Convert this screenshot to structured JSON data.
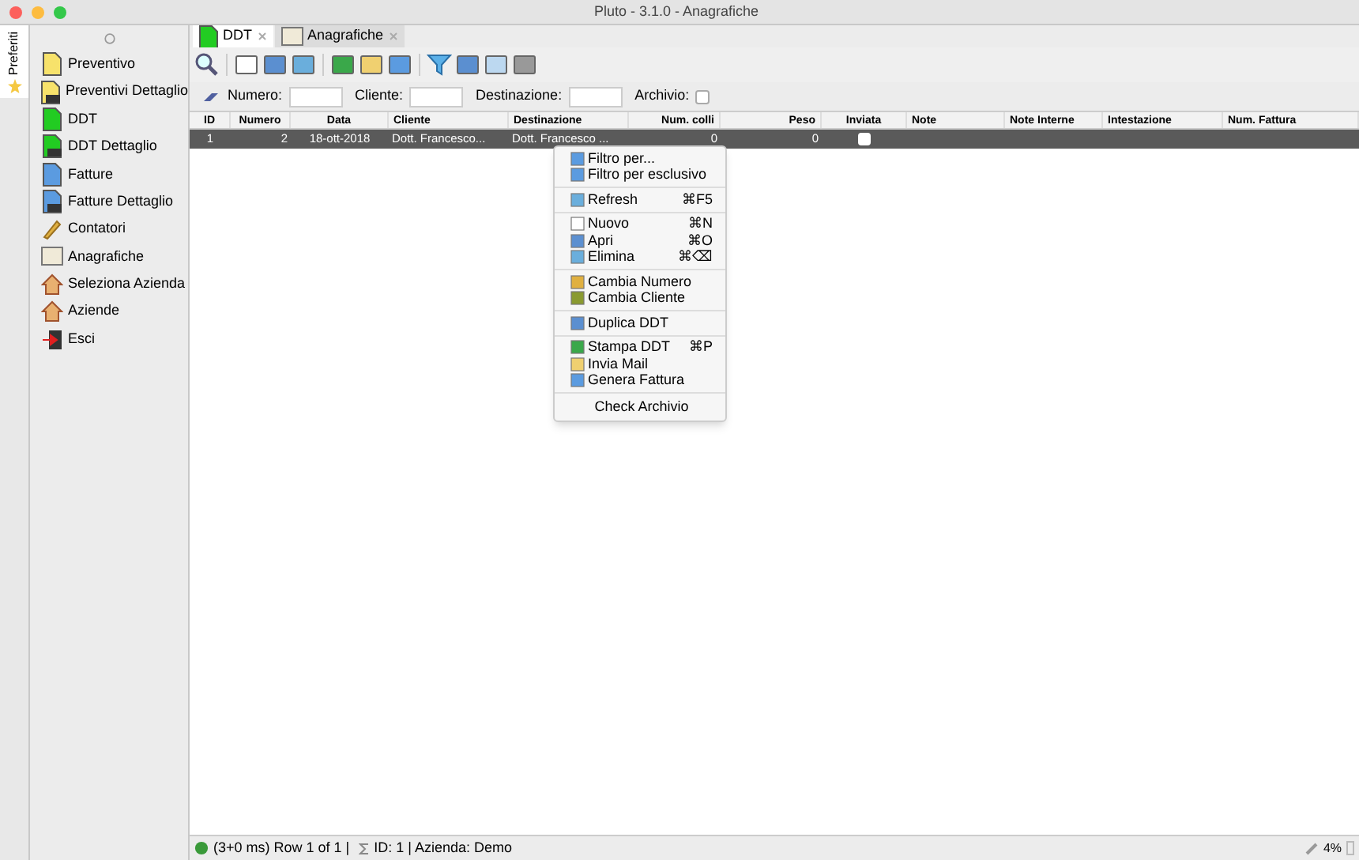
{
  "window": {
    "title": "Pluto - 3.1.0 - Anagrafiche"
  },
  "side_tab": {
    "label": "Preferiti"
  },
  "sidebar": {
    "items": [
      {
        "label": "Preventivo"
      },
      {
        "label": "Preventivi Dettaglio"
      },
      {
        "label": "DDT"
      },
      {
        "label": "DDT Dettaglio"
      },
      {
        "label": "Fatture"
      },
      {
        "label": "Fatture Dettaglio"
      },
      {
        "label": "Contatori"
      },
      {
        "label": "Anagrafiche"
      },
      {
        "label": "Seleziona Azienda"
      },
      {
        "label": "Aziende"
      },
      {
        "label": "Esci"
      }
    ]
  },
  "tabs": [
    {
      "label": "DDT",
      "selected": true
    },
    {
      "label": "Anagrafiche",
      "selected": false
    }
  ],
  "filters": [
    {
      "label": "Numero:",
      "kind": "text"
    },
    {
      "label": "Cliente:",
      "kind": "text"
    },
    {
      "label": "Destinazione:",
      "kind": "text"
    },
    {
      "label": "Archivio:",
      "kind": "check",
      "checked": false
    }
  ],
  "table": {
    "columns": [
      "ID",
      "Numero",
      "Data",
      "Cliente",
      "Destinazione",
      "Num. colli",
      "Peso",
      "Inviata",
      "Note",
      "Note Interne",
      "Intestazione",
      "Num. Fattura"
    ],
    "rows": [
      {
        "selected": true,
        "inviata": false,
        "cells": [
          "1",
          "2",
          "18-ott-2018",
          "Dott. Francesco...",
          "Dott. Francesco ...",
          "0",
          "0",
          "",
          "",
          "",
          "",
          ""
        ]
      }
    ]
  },
  "context_menu": {
    "groups": [
      [
        {
          "label": "Filtro per..."
        },
        {
          "label": "Filtro per esclusivo"
        }
      ],
      [
        {
          "label": "Refresh",
          "shortcut": "⌘F5"
        }
      ],
      [
        {
          "label": "Nuovo",
          "shortcut": "⌘N"
        },
        {
          "label": "Apri",
          "shortcut": "⌘O"
        },
        {
          "label": "Elimina",
          "shortcut": "⌘⌫"
        }
      ],
      [
        {
          "label": "Cambia Numero"
        },
        {
          "label": "Cambia Cliente"
        }
      ],
      [
        {
          "label": "Duplica DDT"
        }
      ],
      [
        {
          "label": "Stampa DDT",
          "shortcut": "⌘P"
        },
        {
          "label": "Invia Mail"
        },
        {
          "label": "Genera Fattura"
        }
      ],
      [
        {
          "label": "Check Archivio",
          "kind": "centered"
        }
      ]
    ]
  },
  "status_bar": {
    "text": "(3+0 ms) Row 1 of 1 | ",
    "text2": "ID: 1 | Azienda: Demo",
    "memory": "4%"
  }
}
